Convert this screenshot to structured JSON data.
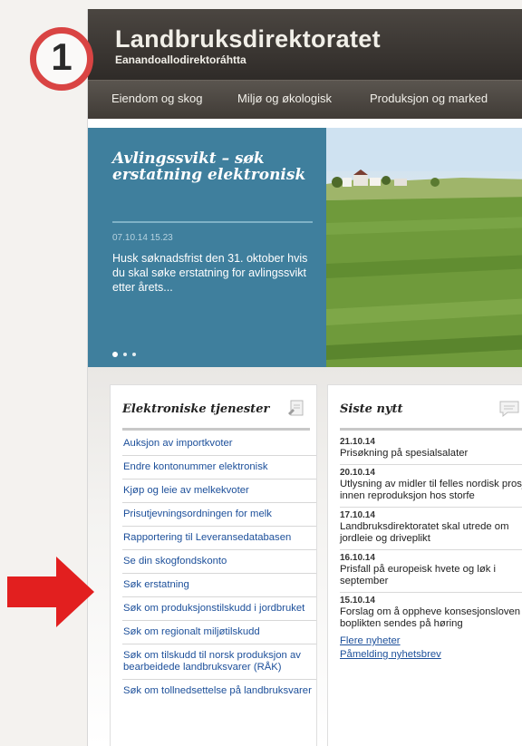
{
  "header": {
    "title": "Landbruksdirektoratet",
    "subtitle": "Eanandoallodirektoráhtta"
  },
  "nav": {
    "items": [
      "Eiendom og skog",
      "Miljø og økologisk",
      "Produksjon og marked"
    ]
  },
  "hero": {
    "title": "Avlingssvikt – søk erstatning elektronisk",
    "date": "07.10.14 15.23",
    "text": "Husk søknadsfrist den 31. oktober hvis du skal søke erstatning for avlingssvikt etter årets..."
  },
  "services": {
    "title": "Elektroniske tjenester",
    "items": [
      "Auksjon av importkvoter",
      "Endre kontonummer elektronisk",
      "Kjøp og leie av melkekvoter",
      "Prisutjevningsordningen for melk",
      "Rapportering til Leveransedatabasen",
      "Se din skogfondskonto",
      "Søk erstatning",
      "Søk om produksjonstilskudd i jordbruket",
      "Søk om regionalt miljøtilskudd",
      "Søk om tilskudd til norsk produksjon av bearbeidede landbruksvarer (RÅK)",
      "Søk om tollnedsettelse på landbruksvarer"
    ]
  },
  "news": {
    "title": "Siste nytt",
    "items": [
      {
        "date": "21.10.14",
        "text": "Prisøkning på spesialsalater"
      },
      {
        "date": "20.10.14",
        "text": "Utlysning av midler til felles nordisk prosjekt innen reproduksjon hos storfe"
      },
      {
        "date": "17.10.14",
        "text": "Landbruksdirektoratet skal utrede om jordleie og driveplikt"
      },
      {
        "date": "16.10.14",
        "text": "Prisfall på europeisk hvete og løk i september"
      },
      {
        "date": "15.10.14",
        "text": "Forslag om å oppheve konsesjonsloven og boplikten sendes på høring"
      }
    ],
    "more_link": "Flere nyheter",
    "subscribe_link": "Påmelding nyhetsbrev"
  },
  "annotation": {
    "step_number": "1"
  },
  "colors": {
    "hero_panel": "#3f7f9d",
    "link": "#1c4f9a",
    "header": "#3a3531",
    "annotation": "#d94443"
  },
  "icons": {
    "services": "document-pencil-icon",
    "news": "speech-bubble-icon",
    "arrow": "arrow-right-icon"
  }
}
